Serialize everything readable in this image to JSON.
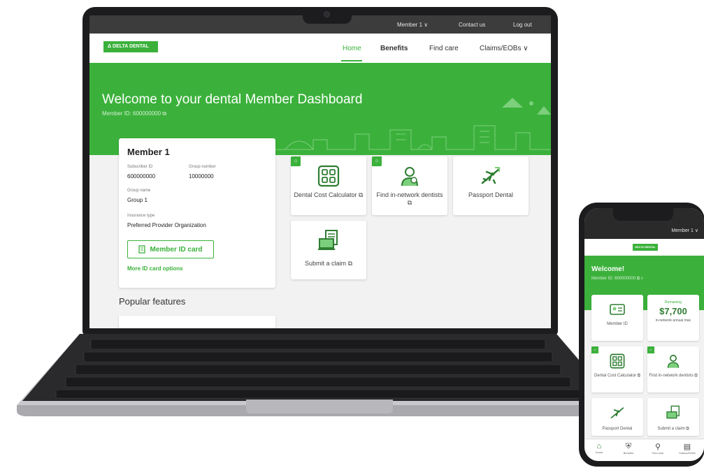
{
  "laptop": {
    "topbar": {
      "member_menu": "Member 1 ∨",
      "contact": "Contact us",
      "logout": "Log out"
    },
    "logo_text": "Δ DELTA DENTAL",
    "nav": {
      "home": "Home",
      "benefits": "Benefits",
      "find_care": "Find care",
      "claims": "Claims/EOBs ∨"
    },
    "hero": {
      "title": "Welcome to your dental Member Dashboard",
      "member_id": "Member ID: 600000000 ⧉"
    },
    "member_card": {
      "name": "Member 1",
      "subscriber_id_label": "Subscriber ID",
      "subscriber_id": "600000000",
      "group_number_label": "Group number",
      "group_number": "10000000",
      "group_name_label": "Group name",
      "group_name": "Group 1",
      "insurance_type_label": "Insurance type",
      "insurance_type": "Preferred Provider Organization",
      "id_card_button": "Member ID card",
      "more_options": "More ID card options"
    },
    "tiles": [
      {
        "label": "Dental Cost Calculator ⧉",
        "icon": "calculator-icon"
      },
      {
        "label": "Find in-network dentists ⧉",
        "icon": "dentist-icon"
      },
      {
        "label": "Passport Dental",
        "icon": "airplane-icon"
      },
      {
        "label": "Submit a claim ⧉",
        "icon": "claim-document-icon"
      }
    ],
    "popular_features": "Popular features"
  },
  "phone": {
    "member_menu": "Member 1 ∨",
    "logo_text": "DELTA DENTAL",
    "welcome": "Welcome!",
    "member_id": "Member ID: 600000000 ⧉ ∨",
    "tiles": {
      "member_id": "Member ID",
      "remaining_label": "Remaining",
      "remaining_amount": "$7,700",
      "remaining_note": "in-network annual max",
      "calculator": "Dental Cost Calculator ⧉",
      "find_dentist": "Find in-network dentists ⧉",
      "passport": "Passport Dental",
      "submit_claim": "Submit a claim ⧉"
    },
    "bottom_nav": [
      {
        "label": "Home",
        "icon": "home-icon"
      },
      {
        "label": "Benefits",
        "icon": "shield-icon"
      },
      {
        "label": "Find care",
        "icon": "search-icon"
      },
      {
        "label": "Claims/EOBs",
        "icon": "document-icon"
      }
    ]
  },
  "colors": {
    "brand_green": "#3bb13b",
    "dark_green": "#2e7d32",
    "device_frame": "#1c1c1e"
  }
}
